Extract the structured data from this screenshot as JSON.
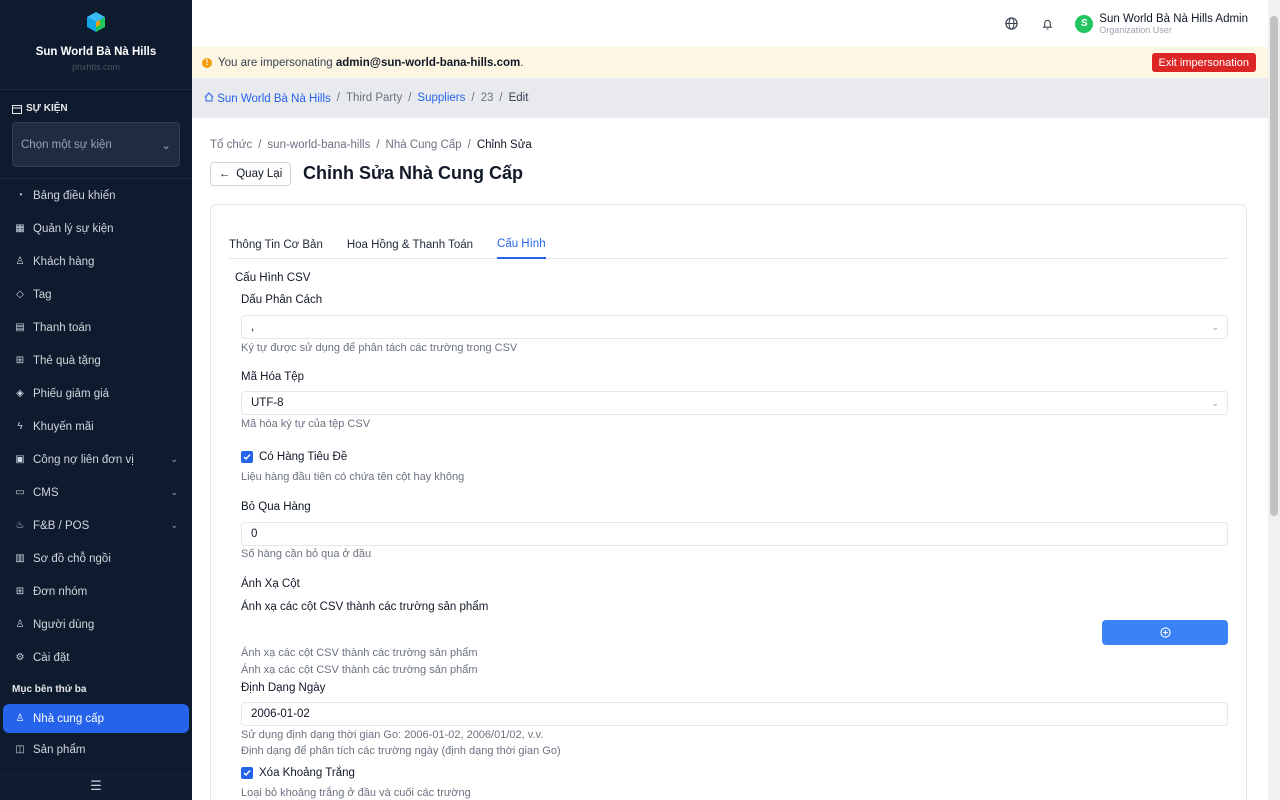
{
  "sidebar": {
    "brand_name": "Sun World Bà Nà Hills",
    "brand_sub": "phxhtls.com",
    "section_label": "SỰ KIỆN",
    "event_select_placeholder": "Chọn một sự kiện",
    "items": [
      {
        "label": "Bảng điều khiển",
        "icon": "dashboard-icon"
      },
      {
        "label": "Quản lý sự kiện",
        "icon": "calendar-icon"
      },
      {
        "label": "Khách hàng",
        "icon": "users-icon"
      },
      {
        "label": "Tag",
        "icon": "tag-icon"
      },
      {
        "label": "Thanh toán",
        "icon": "receipt-icon"
      },
      {
        "label": "Thẻ quà tặng",
        "icon": "gift-icon"
      },
      {
        "label": "Phiếu giảm giá",
        "icon": "coupon-icon"
      },
      {
        "label": "Khuyến mãi",
        "icon": "bolt-icon"
      },
      {
        "label": "Công nợ liên đơn vị",
        "icon": "ledger-icon"
      },
      {
        "label": "CMS",
        "icon": "cms-icon"
      },
      {
        "label": "F&B / POS",
        "icon": "food-icon"
      },
      {
        "label": "Sơ đồ chỗ ngồi",
        "icon": "seatmap-icon"
      },
      {
        "label": "Đơn nhóm",
        "icon": "grid-icon"
      },
      {
        "label": "Người dùng",
        "icon": "user-icon"
      },
      {
        "label": "Cài đặt",
        "icon": "gear-icon"
      }
    ],
    "group_label": "Mục bên thứ ba",
    "third_party": [
      {
        "label": "Nhà cung cấp",
        "icon": "user-icon"
      },
      {
        "label": "Sản phẩm",
        "icon": "bag-icon"
      }
    ]
  },
  "topbar": {
    "user_initial": "S",
    "user_name": "Sun World Bà Nà Hills Admin",
    "user_role": "Organization User"
  },
  "impersonation": {
    "prefix": "You are impersonating",
    "email": "admin@sun-world-bana-hills.com",
    "suffix": ".",
    "exit_label": "Exit impersonation"
  },
  "top_breadcrumb": {
    "home": "Sun World Bà Nà Hills",
    "third_party": "Third Party",
    "suppliers": "Suppliers",
    "id": "23",
    "edit": "Edit"
  },
  "page": {
    "crumb_org": "Tổ chức",
    "crumb_slug": "sun-world-bana-hills",
    "crumb_suppliers": "Nhà Cung Cấp",
    "crumb_edit": "Chỉnh Sửa",
    "back_label": "Quay Lại",
    "title": "Chỉnh Sửa Nhà Cung Cấp"
  },
  "tabs": [
    "Thông Tin Cơ Bản",
    "Hoa Hồng & Thanh Toán",
    "Cấu Hình"
  ],
  "form": {
    "section_title": "Cấu Hình CSV",
    "delimiter_label": "Dấu Phân Cách",
    "delimiter_value": ",",
    "delimiter_hint": "Ký tự được sử dụng để phân tách các trường trong CSV",
    "encoding_label": "Mã Hóa Tệp",
    "encoding_value": "UTF-8",
    "encoding_hint": "Mã hóa ký tự của tệp CSV",
    "header_label": "Có Hàng Tiêu Đề",
    "header_hint": "Liệu hàng đầu tiên có chứa tên cột hay không",
    "skip_label": "Bỏ Qua Hàng",
    "skip_value": "0",
    "skip_hint": "Số hàng cần bỏ qua ở đầu",
    "mapping_label": "Ánh Xạ Cột",
    "mapping_desc": "Ánh xạ các cột CSV thành các trường sản phẩm",
    "mapping_hint1": "Ánh xạ các cột CSV thành các trường sản phẩm",
    "mapping_hint2": "Ánh xạ các cột CSV thành các trường sản phẩm",
    "date_label": "Định Dạng Ngày",
    "date_value": "2006-01-02",
    "date_hint1": "Sử dụng định dạng thời gian Go: 2006-01-02, 2006/01/02, v.v.",
    "date_hint2": "Định dạng để phân tích các trường ngày (định dạng thời gian Go)",
    "trim_label": "Xóa Khoảng Trắng",
    "trim_hint": "Loại bỏ khoảng trắng ở đầu và cuối các trường"
  },
  "colors": {
    "sidebar_bg": "#0e1b2e",
    "accent": "#2563eb",
    "danger": "#dc2626",
    "warning_bg": "#fdf6e3"
  }
}
